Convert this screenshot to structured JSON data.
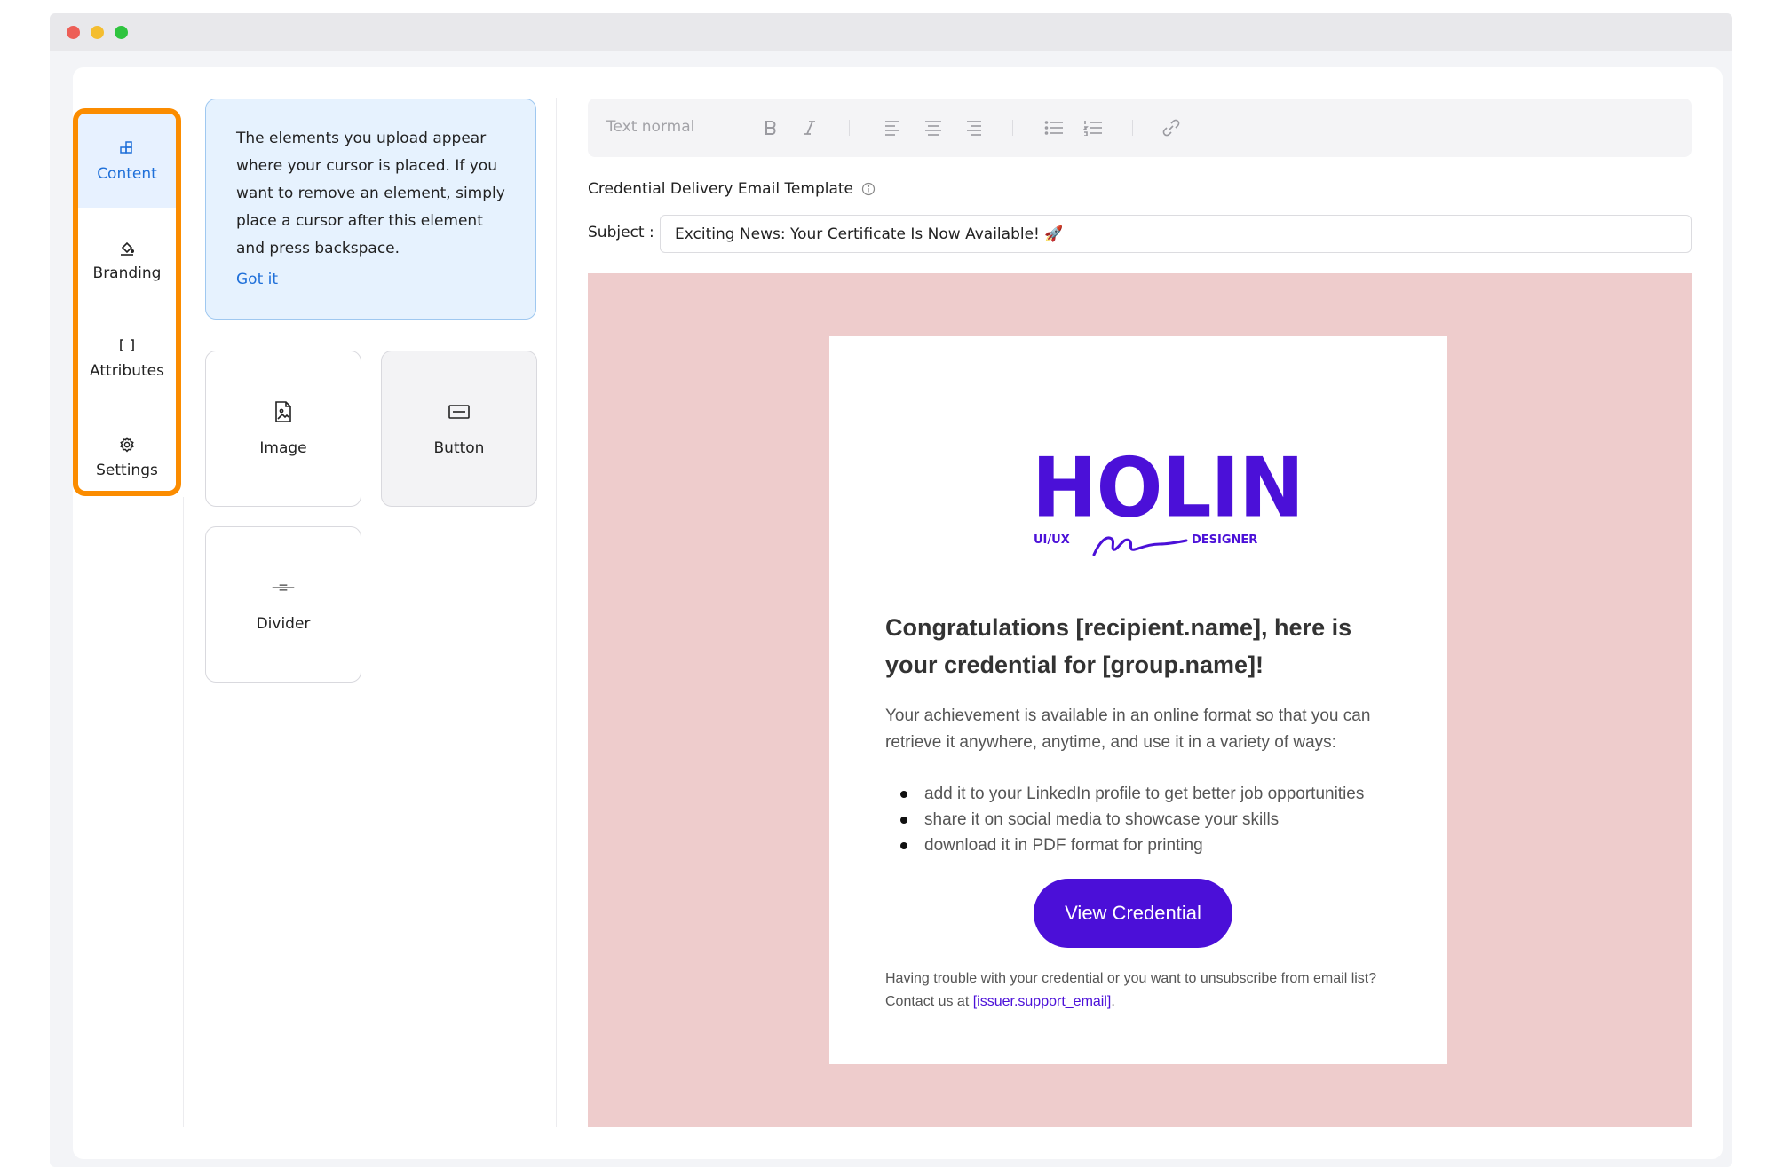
{
  "nav": {
    "items": [
      {
        "label": "Content",
        "icon": "content-blocks-icon"
      },
      {
        "label": "Branding",
        "icon": "paint-bucket-icon"
      },
      {
        "label": "Attributes",
        "icon": "brackets-icon"
      },
      {
        "label": "Settings",
        "icon": "gear-icon"
      }
    ],
    "highlight_color": "#fb8c00",
    "active_color": "#1e6fd9"
  },
  "tip": {
    "text": "The elements you upload appear where your cursor is placed. If you want to remove an element, simply place a cursor after this element and press backspace.",
    "link": "Got it"
  },
  "blocks": [
    {
      "label": "Image",
      "icon": "image-file-icon"
    },
    {
      "label": "Button",
      "icon": "button-icon"
    },
    {
      "label": "Divider",
      "icon": "divider-icon"
    }
  ],
  "toolbar": {
    "text_style": "Text normal",
    "buttons": [
      "bold-icon",
      "italic-icon",
      "align-left-icon",
      "align-center-icon",
      "align-right-icon",
      "bullet-list-icon",
      "numbered-list-icon",
      "link-icon"
    ]
  },
  "template": {
    "title": "Credential Delivery Email Template",
    "subject_label": "Subject :",
    "subject_value": "Exciting News: Your Certificate Is Now Available! 🚀"
  },
  "email": {
    "background": "#eecccc",
    "logo": {
      "word": "HOLIN",
      "left": "UI/UX",
      "right": "DESIGNER",
      "color": "#4b10d8"
    },
    "heading": "Congratulations [recipient.name], here is your credential for [group.name]!",
    "paragraph": "Your achievement is available in an online format so that you can retrieve it anywhere, anytime, and use it in a variety of ways:",
    "list": [
      "add it to your LinkedIn profile to get better job opportunities",
      "share it on social media to showcase your skills",
      "download it in PDF format for printing"
    ],
    "cta": "View Credential",
    "cta_color": "#4b0fd8",
    "footer_text": "Having trouble with your credential or you want to unsubscribe from email list? Contact us at ",
    "footer_link": "[issuer.support_email]",
    "footer_end": "."
  }
}
